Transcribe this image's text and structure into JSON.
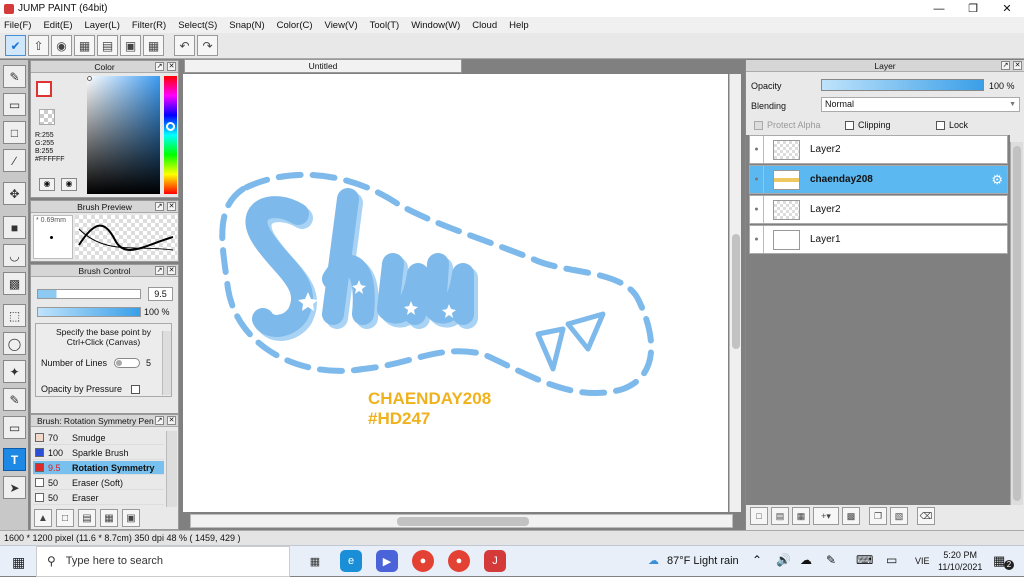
{
  "app": {
    "title": "JUMP PAINT (64bit)"
  },
  "menu": [
    "File(F)",
    "Edit(E)",
    "Layer(L)",
    "Filter(R)",
    "Select(S)",
    "Snap(N)",
    "Color(C)",
    "View(V)",
    "Tool(T)",
    "Window(W)",
    "Cloud",
    "Help"
  ],
  "document": {
    "tab": "Untitled"
  },
  "color_panel": {
    "title": "Color",
    "r": "R:255",
    "g": "G:255",
    "b": "B:255",
    "hex": "#FFFFFF"
  },
  "brush_preview": {
    "title": "Brush Preview",
    "size": "0.69mm"
  },
  "brush_control": {
    "title": "Brush Control",
    "size": "9.5",
    "opacity": "100 %",
    "hint": "Specify the base point by Ctrl+Click (Canvas)",
    "lines_label": "Number of Lines",
    "lines_value": "5",
    "pressure_label": "Opacity by Pressure"
  },
  "brush_list": {
    "title": "Brush: Rotation Symmetry Pen",
    "items": [
      {
        "size": "70",
        "name": "Smudge",
        "color": "#f3d9c9"
      },
      {
        "size": "100",
        "name": "Sparkle Brush",
        "color": "#2a50d8"
      },
      {
        "size": "9.5",
        "name": "Rotation Symmetry",
        "color": "#e02a2a"
      },
      {
        "size": "50",
        "name": "Eraser (Soft)",
        "color": "#ffffff"
      },
      {
        "size": "50",
        "name": "Eraser",
        "color": "#ffffff"
      }
    ]
  },
  "layer_panel": {
    "title": "Layer",
    "opacity_label": "Opacity",
    "opacity_value": "100 %",
    "blending_label": "Blending",
    "blending_value": "Normal",
    "protect_alpha": "Protect Alpha",
    "clipping": "Clipping",
    "lock": "Lock",
    "layers": [
      {
        "name": "Layer2"
      },
      {
        "name": "chaenday208"
      },
      {
        "name": "Layer2"
      },
      {
        "name": "Layer1"
      }
    ]
  },
  "canvas_art": {
    "line1": "CHAENDAY208",
    "line2": "#HD247",
    "script": "Shu"
  },
  "status": {
    "text": "1600 * 1200 pixel   (11.6 * 8.7cm)   350 dpi   48 %   ( 1459, 429 )"
  },
  "taskbar": {
    "search_placeholder": "Type here to search",
    "weather": "87°F  Light rain",
    "lang": "VIE",
    "time": "5:20 PM",
    "date": "11/10/2021",
    "notif": "2"
  },
  "colors": {
    "accent": "#1e88e5",
    "selected_layer": "#5bb8f0",
    "art_blue": "#7db9ea",
    "art_gold": "#f0b21c"
  }
}
